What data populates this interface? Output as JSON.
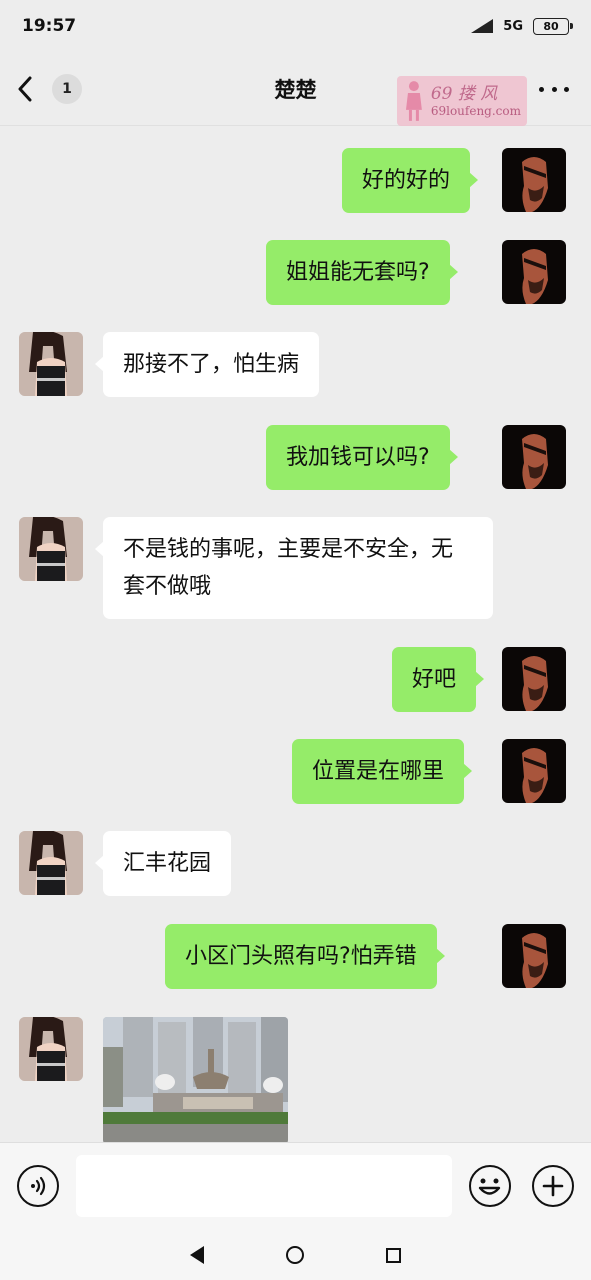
{
  "status_bar": {
    "time": "19:57",
    "network": "5G",
    "battery": "80"
  },
  "header": {
    "title": "楚楚",
    "unread_count": "1"
  },
  "watermark": {
    "top": "69 搂 风",
    "bottom": "69loufeng.com"
  },
  "messages": [
    {
      "from": "me",
      "text": "好的好的"
    },
    {
      "from": "me",
      "text": "姐姐能无套吗?"
    },
    {
      "from": "her",
      "text": "那接不了，怕生病"
    },
    {
      "from": "me",
      "text": "我加钱可以吗?"
    },
    {
      "from": "her",
      "text": "不是钱的事呢，主要是不安全，无套不做哦"
    },
    {
      "from": "me",
      "text": "好吧"
    },
    {
      "from": "me",
      "text": "位置是在哪里"
    },
    {
      "from": "her",
      "text": "汇丰花园"
    },
    {
      "from": "me",
      "text": "小区门头照有吗?怕弄错"
    },
    {
      "from": "her",
      "type": "image",
      "text": ""
    }
  ],
  "colors": {
    "outgoing_bubble": "#95ec69",
    "incoming_bubble": "#ffffff",
    "background": "#ededed"
  }
}
